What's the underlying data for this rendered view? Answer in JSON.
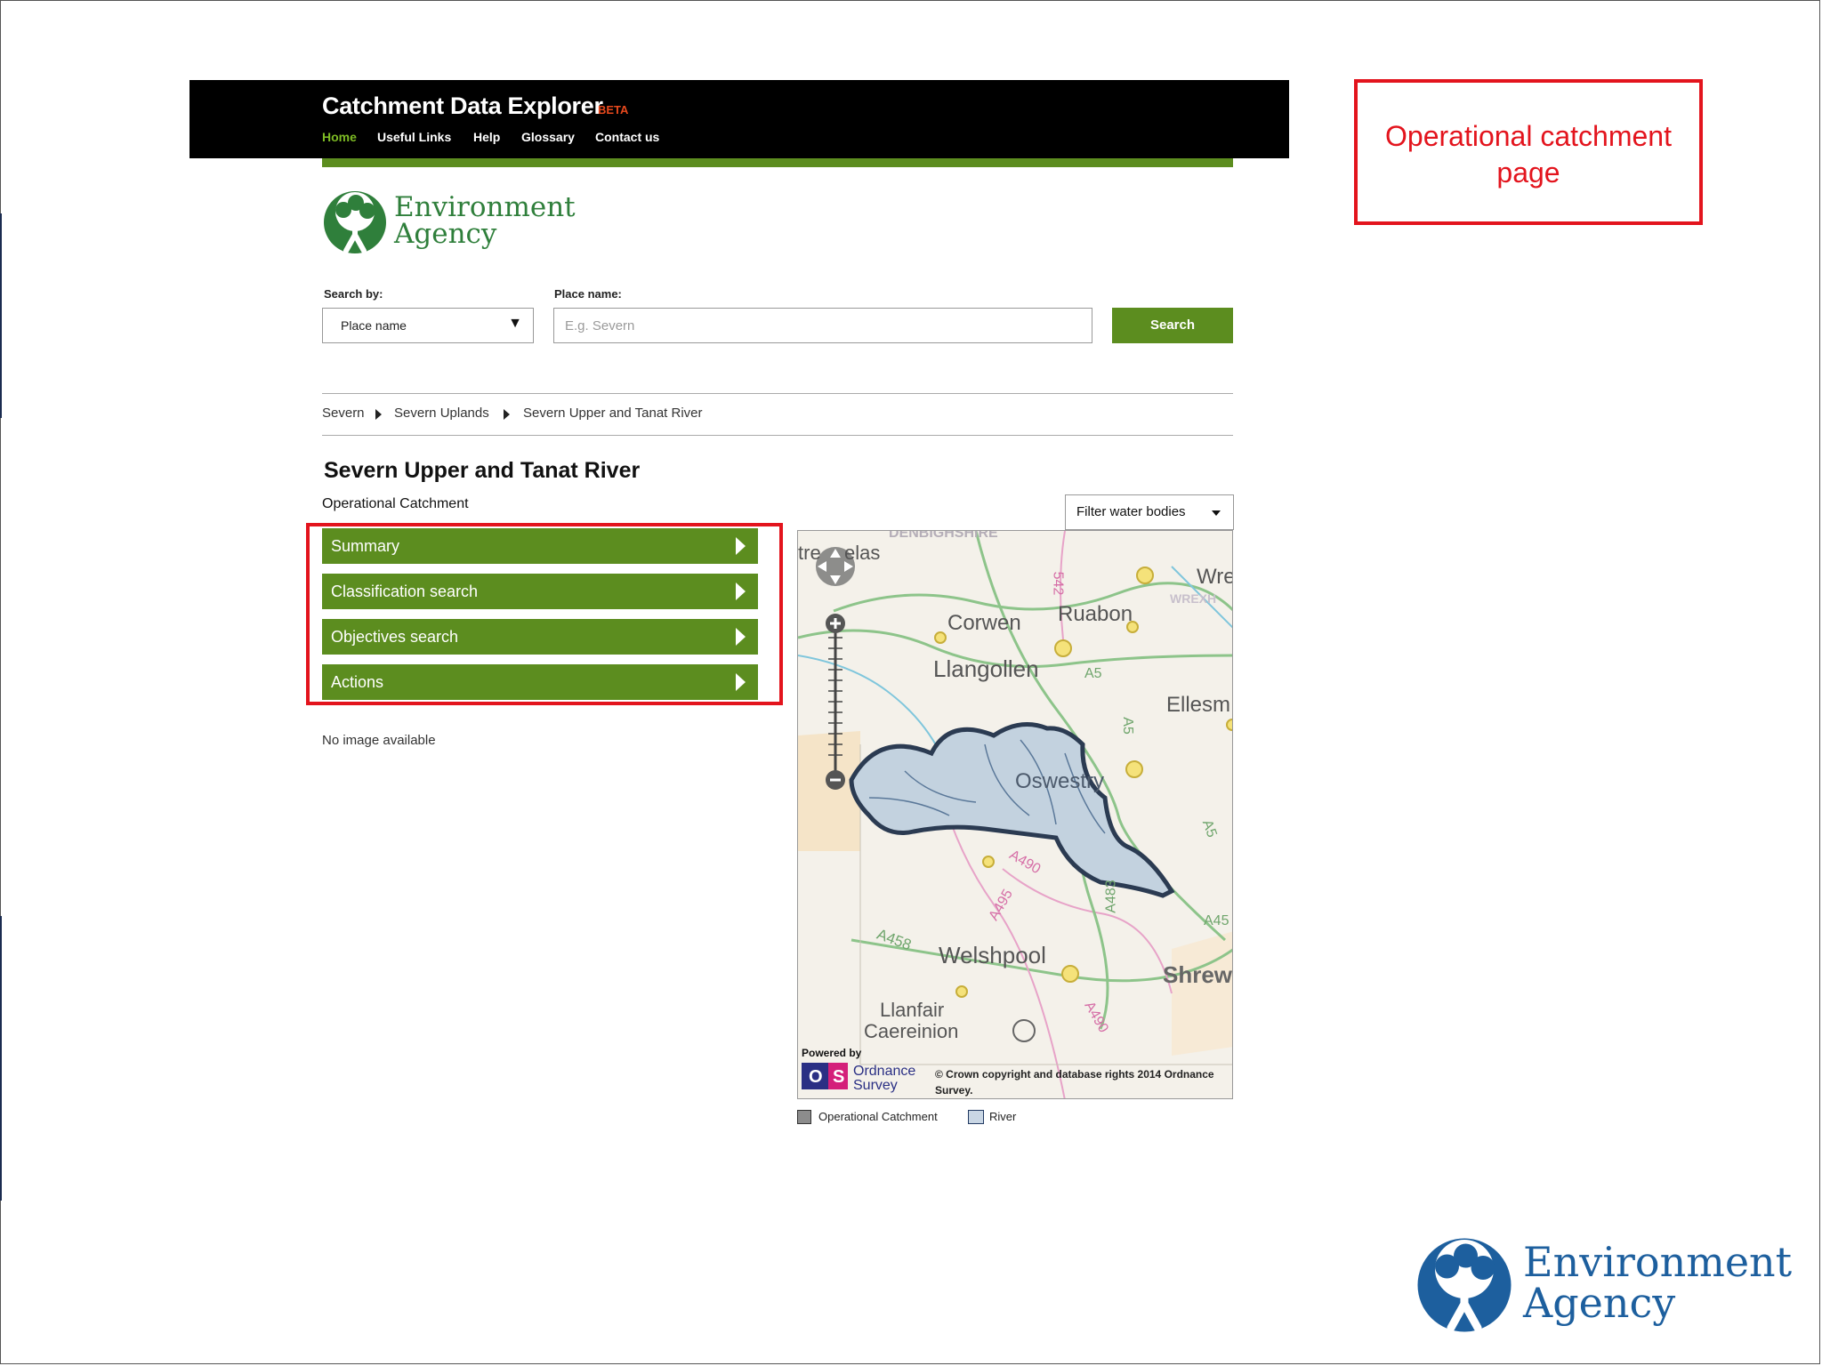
{
  "app": {
    "title": "Catchment Data Explorer",
    "badge": "BETA"
  },
  "nav": [
    "Home",
    "Useful Links",
    "Help",
    "Glossary",
    "Contact us"
  ],
  "logo": {
    "line1": "Environment",
    "line2": "Agency"
  },
  "search": {
    "search_by_label": "Search by:",
    "search_by_value": "Place name",
    "place_label": "Place name:",
    "place_placeholder": "E.g. Severn",
    "button": "Search"
  },
  "breadcrumb": [
    "Severn",
    "Severn Uplands",
    "Severn Upper and Tanat River"
  ],
  "page": {
    "title": "Severn Upper and Tanat River",
    "subtitle": "Operational Catchment",
    "no_image": "No image available"
  },
  "menu": [
    "Summary",
    "Classification search",
    "Objectives search",
    "Actions"
  ],
  "map": {
    "filter_button": "Filter water bodies",
    "place_labels": [
      "Corwen",
      "Ruabon",
      "Llangollen",
      "Ellesm",
      "Oswestry",
      "Welshpool",
      "Shrew",
      "Llanfair",
      "Caereinion",
      "tre",
      "elas",
      "Wre",
      "WREXH",
      "DENBIGHSHIRE"
    ],
    "road_labels": [
      "A5",
      "A5",
      "A5",
      "A483",
      "A490",
      "A495",
      "A458",
      "A490",
      "A45",
      "542"
    ],
    "powered_by": "Powered by",
    "os_brand": [
      "Ordnance",
      "Survey"
    ],
    "copyright": "© Crown copyright and database rights 2014 Ordnance Survey."
  },
  "legend": [
    "Operational Catchment",
    "River"
  ],
  "callout": "Operational catchment page",
  "colors": {
    "header": "#000000",
    "green": "#5c8d1f",
    "nav_active": "#7dbb24",
    "beta": "#e8491d",
    "highlight": "#e3141d",
    "ea_green": "#2f7f3b",
    "ea_blue": "#1d5f9e"
  },
  "icons": {
    "zoom_in": "plus-icon",
    "zoom_out": "minus-icon",
    "pan": "pan-arrows-icon",
    "menu_arrow": "triangle-right-icon",
    "dropdown": "caret-down-icon"
  }
}
